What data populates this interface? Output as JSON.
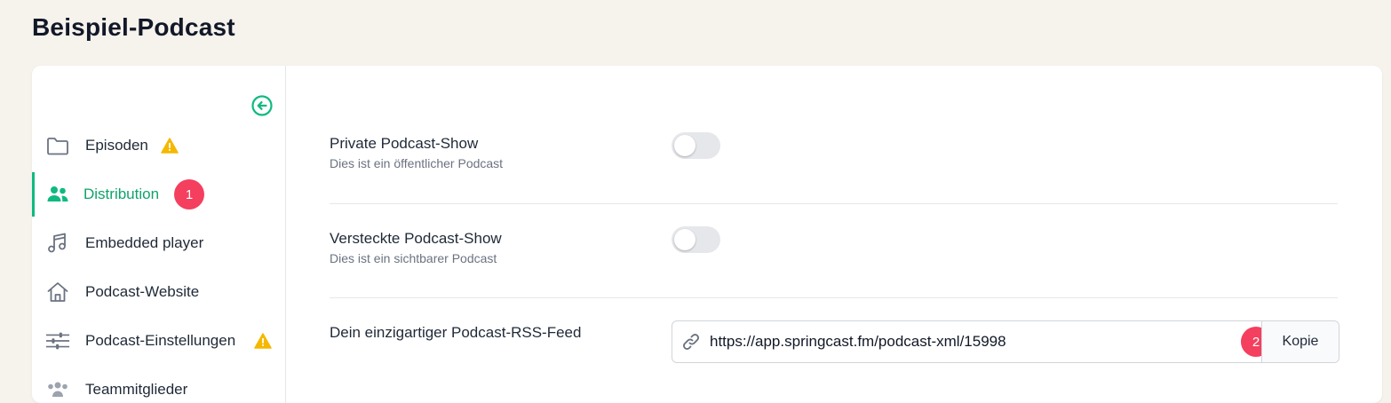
{
  "header": {
    "title": "Beispiel-Podcast"
  },
  "sidebar": {
    "collapse_icon": "arrow-left-circle-icon",
    "items": [
      {
        "label": "Episoden",
        "icon": "folder-icon",
        "warning": true
      },
      {
        "label": "Distribution",
        "icon": "users-icon",
        "active": true,
        "badge": "1"
      },
      {
        "label": "Embedded player",
        "icon": "music-note-icon"
      },
      {
        "label": "Podcast-Website",
        "icon": "home-icon"
      },
      {
        "label": "Podcast-Einstellungen",
        "icon": "sliders-icon",
        "warning": true
      },
      {
        "label": "Teammitglieder",
        "icon": "team-icon"
      }
    ]
  },
  "main": {
    "private_show": {
      "label": "Private Podcast-Show",
      "description": "Dies ist ein öffentlicher Podcast",
      "enabled": false
    },
    "hidden_show": {
      "label": "Versteckte Podcast-Show",
      "description": "Dies ist ein sichtbarer Podcast",
      "enabled": false
    },
    "rss_feed": {
      "label": "Dein einzigartiger Podcast-RSS-Feed",
      "url": "https://app.springcast.fm/podcast-xml/15998",
      "copy_label": "Kopie",
      "badge": "2"
    }
  },
  "colors": {
    "accent": "#10b981",
    "accent_text": "#10a36b",
    "badge": "#f43f5e",
    "warning": "#f5b800",
    "background": "#f6f2ec"
  }
}
